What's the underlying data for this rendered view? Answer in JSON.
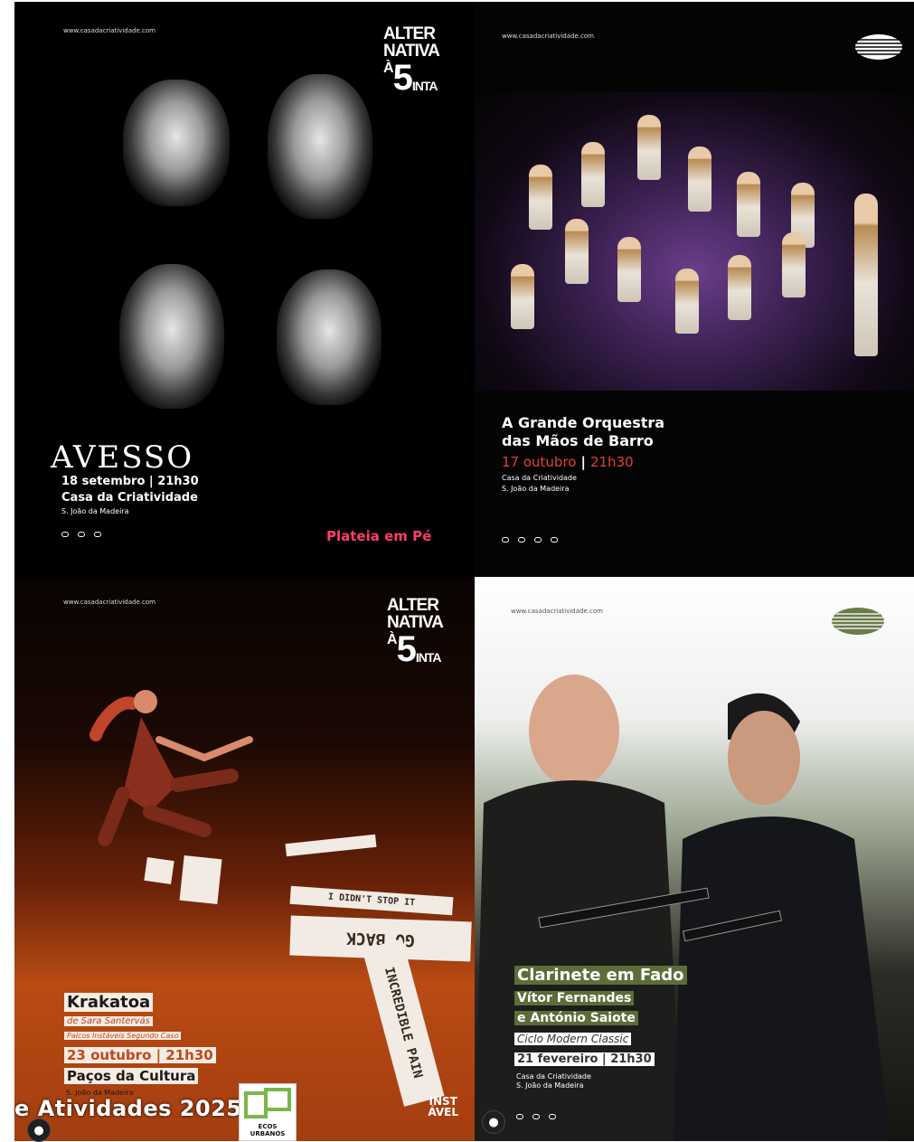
{
  "posters": {
    "p1": {
      "url": "www.casadacriatividade.com",
      "logo_line1": "ALTER",
      "logo_line2": "NATIVA",
      "logo_line3": "À",
      "logo_big": "5",
      "logo_line4": "INTA",
      "title": "AVESSO",
      "date": "18 setembro | 21h30",
      "venue": "Casa da Criatividade",
      "city": "S. João da Madeira",
      "note": "Plateia em Pé"
    },
    "p2": {
      "url": "www.casadacriatividade.com",
      "title_line1": "A Grande Orquestra",
      "title_line2": "das Mãos de Barro",
      "date_day": "17 outubro",
      "date_sep": "|",
      "date_time": "21h30",
      "venue": "Casa da Criatividade",
      "city": "S. João da Madeira"
    },
    "p3": {
      "url": "www.casadacriatividade.com",
      "logo_line1": "ALTER",
      "logo_line2": "NATIVA",
      "logo_line3": "À",
      "logo_big": "5",
      "logo_line4": "INTA",
      "paper1": "I DIDN'T STOP IT",
      "paper2": "GO BACK",
      "paper3": "INCREDIBLE PAIN",
      "title": "Krakatoa",
      "author": "de Sara Santervás",
      "series": "Palcos Instáveis Segundo Caso",
      "date": "23 outubro | 21h30",
      "venue": "Paços da Cultura",
      "city": "S. João da Madeira",
      "inst_logo1": "INST",
      "inst_logo2": "ÁVEL"
    },
    "p4": {
      "url": "www.casadacriatividade.com",
      "title": "Clarinete em Fado",
      "artist1": "Vítor Fernandes",
      "artist2": "e António Saiote",
      "series": "Ciclo Modern Classic",
      "date": "21 fevereiro | 21h30",
      "venue": "Casa da Criatividade",
      "city": "S. João da Madeira"
    }
  },
  "caption": "e Atividades 2025 |",
  "badge": {
    "text": "ECOS URBANOS"
  },
  "avatar_icon": "person-icon"
}
